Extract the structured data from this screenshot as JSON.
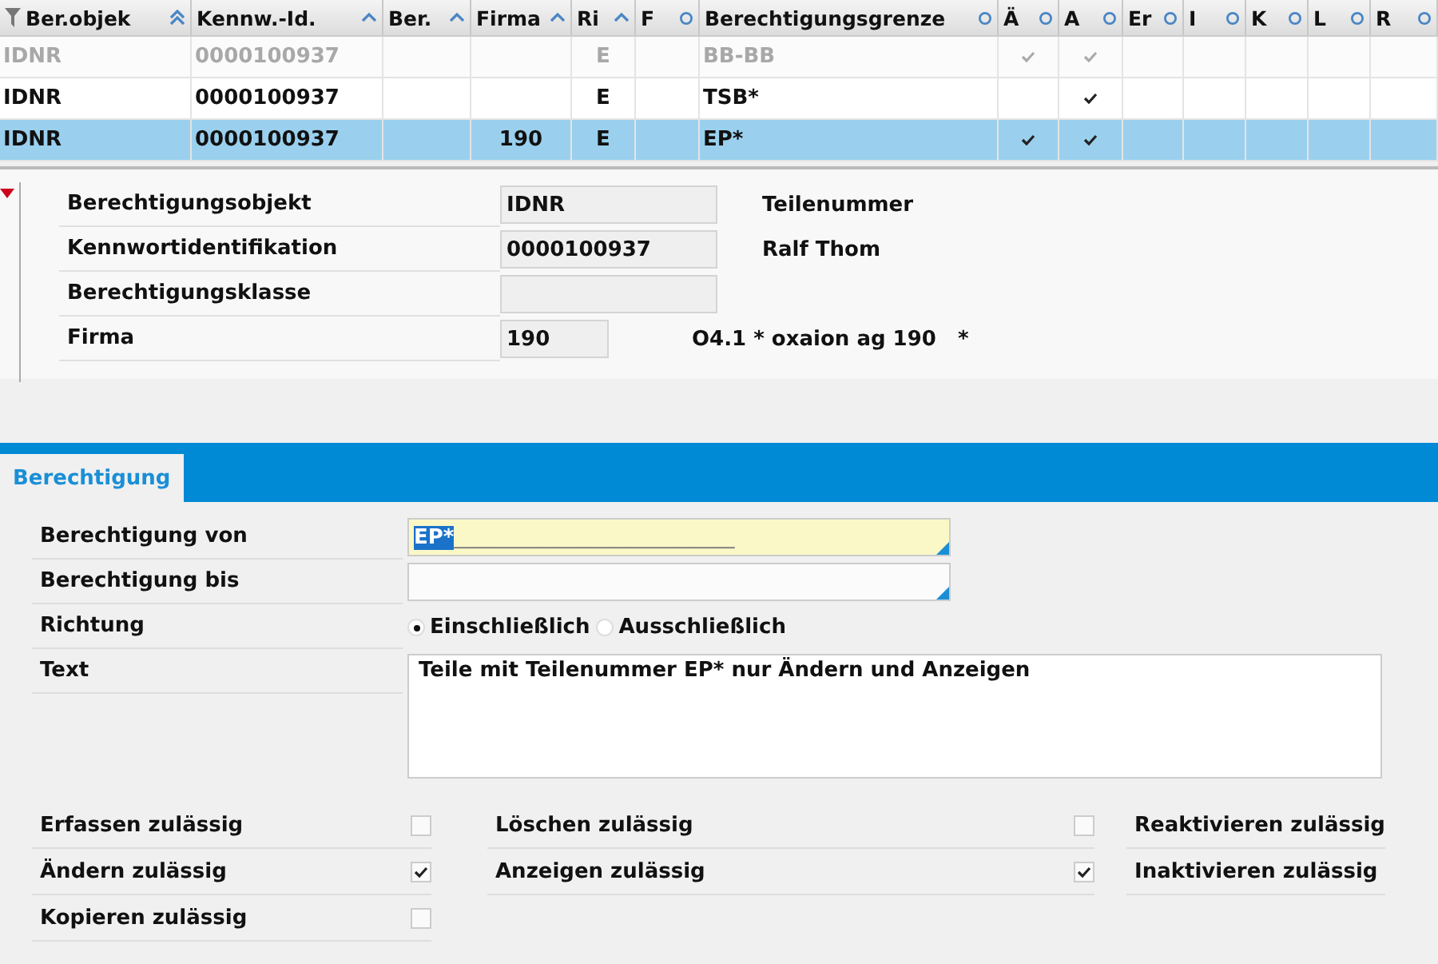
{
  "table": {
    "columns": [
      {
        "label": "Ber.objek",
        "filter": true,
        "kind": "primary"
      },
      {
        "label": "Kennw.-Id.",
        "filter": false,
        "kind": "sorted"
      },
      {
        "label": "Ber.",
        "filter": false,
        "kind": "sorted"
      },
      {
        "label": "Firma",
        "filter": false,
        "kind": "sorted"
      },
      {
        "label": "Ri",
        "filter": false,
        "kind": "sorted"
      },
      {
        "label": "F",
        "filter": false,
        "kind": "unsorted"
      },
      {
        "label": "Berechtigungsgrenze",
        "filter": false,
        "kind": "unsorted"
      },
      {
        "label": "Ä",
        "filter": false,
        "kind": "unsorted"
      },
      {
        "label": "A",
        "filter": false,
        "kind": "unsorted"
      },
      {
        "label": "Er",
        "filter": false,
        "kind": "unsorted"
      },
      {
        "label": "I",
        "filter": false,
        "kind": "unsorted"
      },
      {
        "label": "K",
        "filter": false,
        "kind": "unsorted"
      },
      {
        "label": "L",
        "filter": false,
        "kind": "unsorted"
      },
      {
        "label": "R",
        "filter": false,
        "kind": "unsorted"
      }
    ],
    "rows": [
      {
        "selected": false,
        "disabled": true,
        "cells": [
          "IDNR",
          "0000100937",
          null,
          null,
          "E",
          null,
          "BB-BB",
          true,
          true,
          false,
          false,
          false,
          false,
          false
        ]
      },
      {
        "selected": false,
        "disabled": false,
        "cells": [
          "IDNR",
          "0000100937",
          null,
          null,
          "E",
          null,
          "TSB*",
          false,
          true,
          false,
          false,
          false,
          false,
          false
        ]
      },
      {
        "selected": true,
        "disabled": false,
        "cells": [
          "IDNR",
          "0000100937",
          null,
          "190",
          "E",
          null,
          "EP*",
          true,
          true,
          false,
          false,
          false,
          false,
          false
        ]
      }
    ]
  },
  "detail": {
    "expanded": true,
    "fields": [
      {
        "label": "Berechtigungsobjekt",
        "value": "IDNR",
        "kind": "long",
        "note": "Teilenummer"
      },
      {
        "label": "Kennwortidentifikation",
        "value": "0000100937",
        "kind": "long",
        "note": "Ralf Thom"
      },
      {
        "label": "Berechtigungsklasse",
        "kind": "long"
      },
      {
        "label": "Firma",
        "value": "190",
        "kind": "short",
        "note": "O4.1 * oxaion ag 190   *"
      }
    ]
  },
  "tabs": [
    {
      "label": "Berechtigung",
      "selected": true
    }
  ],
  "form": {
    "von": {
      "label": "Berechtigung von",
      "value": "EP*",
      "fill": "___________________________",
      "focused": true
    },
    "bis": {
      "label": "Berechtigung bis",
      "focused": false
    },
    "richtung": {
      "label": "Richtung",
      "options": [
        {
          "label": "Einschließlich",
          "selected": true
        },
        {
          "label": "Ausschließlich",
          "selected": false
        }
      ]
    },
    "text": {
      "label": "Text",
      "value": "Teile mit Teilenummer EP* nur Ändern und Anzeigen"
    }
  },
  "permissions": [
    [
      {
        "label": "Erfassen zulässig",
        "checked": false
      },
      {
        "label": "Ändern zulässig",
        "checked": true
      },
      {
        "label": "Kopieren zulässig",
        "checked": false
      }
    ],
    [
      {
        "label": "Löschen zulässig",
        "checked": false
      },
      {
        "label": "Anzeigen zulässig",
        "checked": true
      }
    ],
    [
      {
        "label": "Reaktivieren zulässig"
      },
      {
        "label": "Inaktivieren zulässig"
      }
    ]
  ]
}
